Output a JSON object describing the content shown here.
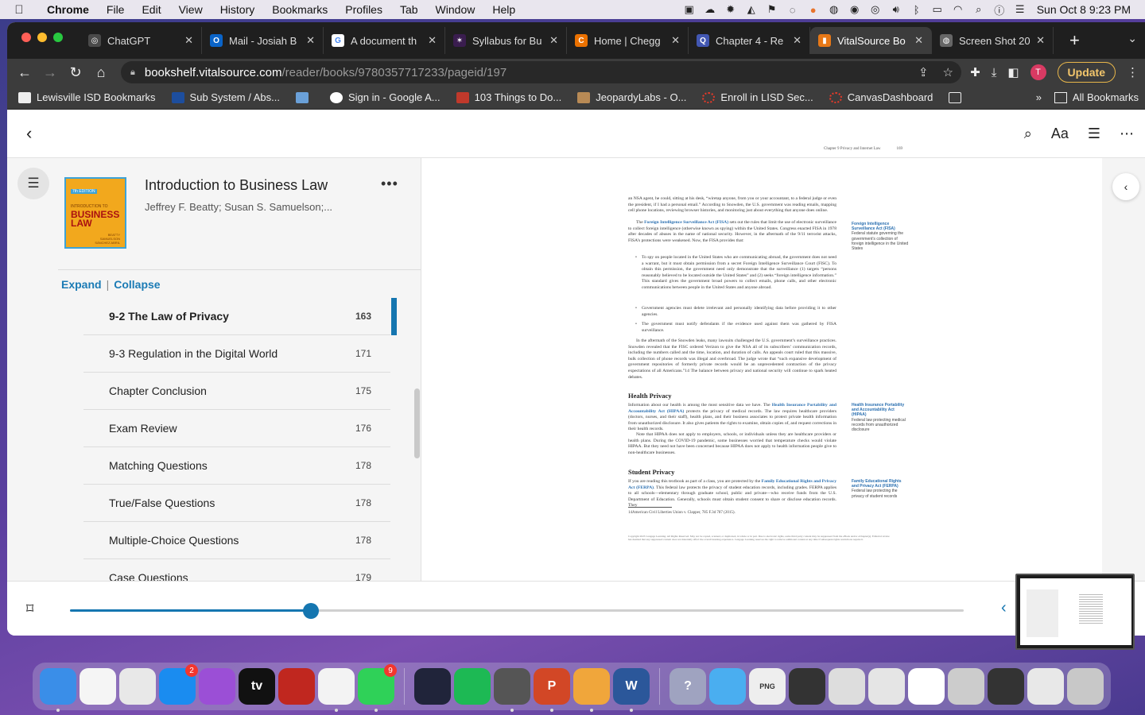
{
  "menubar": {
    "apple": "",
    "app_name": "Chrome",
    "items": [
      "File",
      "Edit",
      "View",
      "History",
      "Bookmarks",
      "Profiles",
      "Tab",
      "Window",
      "Help"
    ],
    "clock": "Sun Oct 8  9:23 PM"
  },
  "tabs": [
    {
      "title": "ChatGPT",
      "icon": "openai-icon",
      "color": "#4a4a4a"
    },
    {
      "title": "Mail - Josiah B",
      "icon": "outlook-icon",
      "color": "#0a64c8"
    },
    {
      "title": "A document th",
      "icon": "google-icon",
      "color": "#ffffff"
    },
    {
      "title": "Syllabus for Bu",
      "icon": "canvas-icon",
      "color": "#3a1d4f"
    },
    {
      "title": "Home | Chegg",
      "icon": "chegg-icon",
      "color": "#eb7100"
    },
    {
      "title": "Chapter 4 - Re",
      "icon": "quizlet-icon",
      "color": "#4257b2"
    },
    {
      "title": "VitalSource Bo",
      "icon": "vitalsource-icon",
      "color": "#e77817",
      "active": true
    },
    {
      "title": "Screen Shot 20",
      "icon": "globe-icon",
      "color": "#666666"
    }
  ],
  "addressbar": {
    "host": "bookshelf.vitalsource.com",
    "path": "/reader/books/9780357717233/pageid/197",
    "update_label": "Update",
    "avatar_letter": "T"
  },
  "bookmarks": [
    {
      "label": "Lewisville ISD Bookmarks",
      "color": "#eeeeee"
    },
    {
      "label": "Sub System / Abs...",
      "color": "#1d4e9e"
    },
    {
      "label": "",
      "color": "#6aa0d8"
    },
    {
      "label": "Sign in - Google A...",
      "color": "#ffffff"
    },
    {
      "label": "103 Things to Do...",
      "color": "#c0392b"
    },
    {
      "label": "JeopardyLabs - O...",
      "color": "#b88a55"
    },
    {
      "label": "Enroll in LISD Sec...",
      "color": "#e23a2a"
    },
    {
      "label": "CanvasDashboard",
      "color": "#e23a2a"
    },
    {
      "label": "",
      "color": "#eeeeee"
    }
  ],
  "bookmarks_more": "»",
  "all_bookmarks": "All Bookmarks",
  "book": {
    "title": "Introduction to Business Law",
    "authors": "Jeffrey F. Beatty; Susan S. Samuelson;...",
    "cover_edition": "7th EDITION",
    "cover_subtitle": "INTRODUCTION TO",
    "cover_title": "BUSINESS LAW",
    "cover_authors": "BEATTY\nSAMUELSON\nSÁNCHEZ ABRIL"
  },
  "toc": {
    "expand": "Expand",
    "separator": "|",
    "collapse": "Collapse",
    "items": [
      {
        "label": "9-2 The Law of Privacy",
        "page": "163",
        "current": true
      },
      {
        "label": "9-3 Regulation in the Digital World",
        "page": "171"
      },
      {
        "label": "Chapter Conclusion",
        "page": "175"
      },
      {
        "label": "Exam Review",
        "page": "176"
      },
      {
        "label": "Matching Questions",
        "page": "178"
      },
      {
        "label": "True/False Questions",
        "page": "178"
      },
      {
        "label": "Multiple-Choice Questions",
        "page": "178"
      },
      {
        "label": "Case Questions",
        "page": "179"
      }
    ]
  },
  "page": {
    "running_head": "Chapter 9     Privacy and Internet Law",
    "page_number": "169",
    "p1": "an NSA agent, he could, sitting at his desk, “wiretap anyone, from you or your accountant, to a federal judge or even the president, if I had a personal email.” According to Snowden, the U.S. government was reading emails, mapping cell phone locations, reviewing browser histories, and monitoring just about everything that anyone does online.",
    "p2_term": "Foreign Intelligence Surveillance Act (FISA)",
    "p2_pre": "The ",
    "p2_post": " sets out the rules that limit the use of electronic surveillance to collect foreign intelligence (otherwise known as spying) within the United States. Congress enacted FISA in 1978 after decades of abuses in the name of national security. However, in the aftermath of the 9/11 terrorist attacks, FISA’s protections were weakened. Now, the FISA provides that:",
    "bullet1": "To spy on people located in the United States who are communicating abroad, the government does not need a warrant, but it must obtain permission from a secret Foreign Intelligence Surveillance Court (FISC). To obtain this permission, the government need only demonstrate that the surveillance (1) targets “persons reasonably believed to be located outside the United States” and (2) seeks “foreign intelligence information.” This standard gives the government broad powers to collect emails, phone calls, and other electronic communications between people in the United States and anyone abroad.",
    "bullet2": "Government agencies must delete irrelevant and personally identifying data before providing it to other agencies.",
    "bullet3": "The government must notify defendants if the evidence used against them was gathered by FISA surveillance.",
    "p3": "In the aftermath of the Snowden leaks, many lawsuits challenged the U.S. government’s surveillance practices. Snowden revealed that the FISC ordered Verizon to give the NSA all of its subscribers’ communication records, including the numbers called and the time, location, and duration of calls. An appeals court ruled that this massive, bulk collection of phone records was illegal and overbroad. The judge wrote that “such expansive development of government repositories of formerly private records would be an unprecedented contraction of the privacy expectations of all Americans.”14 The balance between privacy and national security will continue to spark heated debates.",
    "h_health": "Health Privacy",
    "p4_pre": "Information about our health is among the most sensitive data we have. The ",
    "p4_term": "Health Insurance Portability and Accountability Act (HIPAA)",
    "p4_post": " protects the privacy of medical records. The law requires healthcare providers (doctors, nurses, and their staff), health plans, and their business associates to protect private health information from unauthorized disclosure. It also gives patients the rights to examine, obtain copies of, and request corrections in their health records.",
    "p5": "Note that HIPAA does not apply to employers, schools, or individuals unless they are healthcare providers or health plans. During the COVID-19 pandemic, some businesses worried that temperature checks would violate HIPAA. But they need not have been concerned because HIPAA does not apply to health information people give to non-healthcare businesses.",
    "h_student": "Student Privacy",
    "p6_pre": "If you are reading this textbook as part of a class, you are protected by the ",
    "p6_term": "Family Educational Rights and Privacy Act (FERPA)",
    "p6_post": ". This federal law protects the privacy of student education records, including grades. FERPA applies to all schools—elementary through graduate school, public and private—who receive funds from the U.S. Department of Education. Generally, schools must obtain student consent to share or disclose education records. They",
    "m1_term": "Foreign Intelligence Surveillance Act (FISA)",
    "m1_def": "Federal statute governing the government’s collection of foreign intelligence in the United States",
    "m2_term": "Health Insurance Portability and Accountability Act (HIPAA)",
    "m2_def": "Federal law protecting medical records from unauthorized disclosure",
    "m3_term": "Family Educational Rights and Privacy Act (FERPA)",
    "m3_def": "Federal law protecting the privacy of student records",
    "footnote": "14American Civil Liberties Union v. Clapper, 785 F.3d 787 (2015).",
    "copyright": "Copyright 2023 Cengage Learning. All Rights Reserved. May not be copied, scanned, or duplicated, in whole or in part. Due to electronic rights, some third party content may be suppressed from the eBook and/or eChapter(s). Editorial review has deemed that any suppressed content does not materially affect the overall learning experience. Cengage Learning reserves the right to remove additional content at any time if subsequent rights restrictions require it."
  },
  "reading_progress": 0.27,
  "dock": [
    {
      "name": "finder-icon",
      "color": "#3a8ee8",
      "label": ""
    },
    {
      "name": "photos-icon",
      "color": "#f5f5f5",
      "label": ""
    },
    {
      "name": "launchpad-icon",
      "color": "#e8e8e8",
      "label": ""
    },
    {
      "name": "app-store-icon",
      "color": "#1a8cf0",
      "label": "",
      "badge": "2"
    },
    {
      "name": "podcasts-icon",
      "color": "#9b4fd6",
      "label": ""
    },
    {
      "name": "apple-tv-icon",
      "color": "#111111",
      "label": "tv"
    },
    {
      "name": "acrobat-icon",
      "color": "#c0271f",
      "label": ""
    },
    {
      "name": "chrome-icon",
      "color": "#f3f3f3",
      "label": ""
    },
    {
      "name": "messages-icon",
      "color": "#2fd158",
      "label": "",
      "badge": "9"
    },
    {
      "name": "webex-icon",
      "color": "#20243a",
      "label": ""
    },
    {
      "name": "spotify-icon",
      "color": "#1db954",
      "label": ""
    },
    {
      "name": "system-utility-icon",
      "color": "#555555",
      "label": ""
    },
    {
      "name": "powerpoint-icon",
      "color": "#d24726",
      "label": "P"
    },
    {
      "name": "keynote-icon",
      "color": "#f0a63b",
      "label": ""
    },
    {
      "name": "word-icon",
      "color": "#2b579a",
      "label": "W"
    },
    {
      "name": "help-icon",
      "color": "#9fa3c0",
      "label": "?"
    },
    {
      "name": "folder-icon",
      "color": "#4aaef0",
      "label": ""
    },
    {
      "name": "png-file-icon",
      "color": "#eeeeee",
      "label": "PNG"
    },
    {
      "name": "recent-thumb-1-icon",
      "color": "#333333",
      "label": ""
    },
    {
      "name": "recent-thumb-2-icon",
      "color": "#dddddd",
      "label": ""
    },
    {
      "name": "recent-thumb-3-icon",
      "color": "#e5e5e5",
      "label": ""
    },
    {
      "name": "recent-thumb-4-icon",
      "color": "#ffffff",
      "label": ""
    },
    {
      "name": "recent-thumb-5-icon",
      "color": "#cccccc",
      "label": ""
    },
    {
      "name": "recent-thumb-6-icon",
      "color": "#333333",
      "label": ""
    },
    {
      "name": "recent-thumb-7-icon",
      "color": "#e8e8e8",
      "label": ""
    },
    {
      "name": "trash-icon",
      "color": "#c8c8c8",
      "label": ""
    }
  ]
}
